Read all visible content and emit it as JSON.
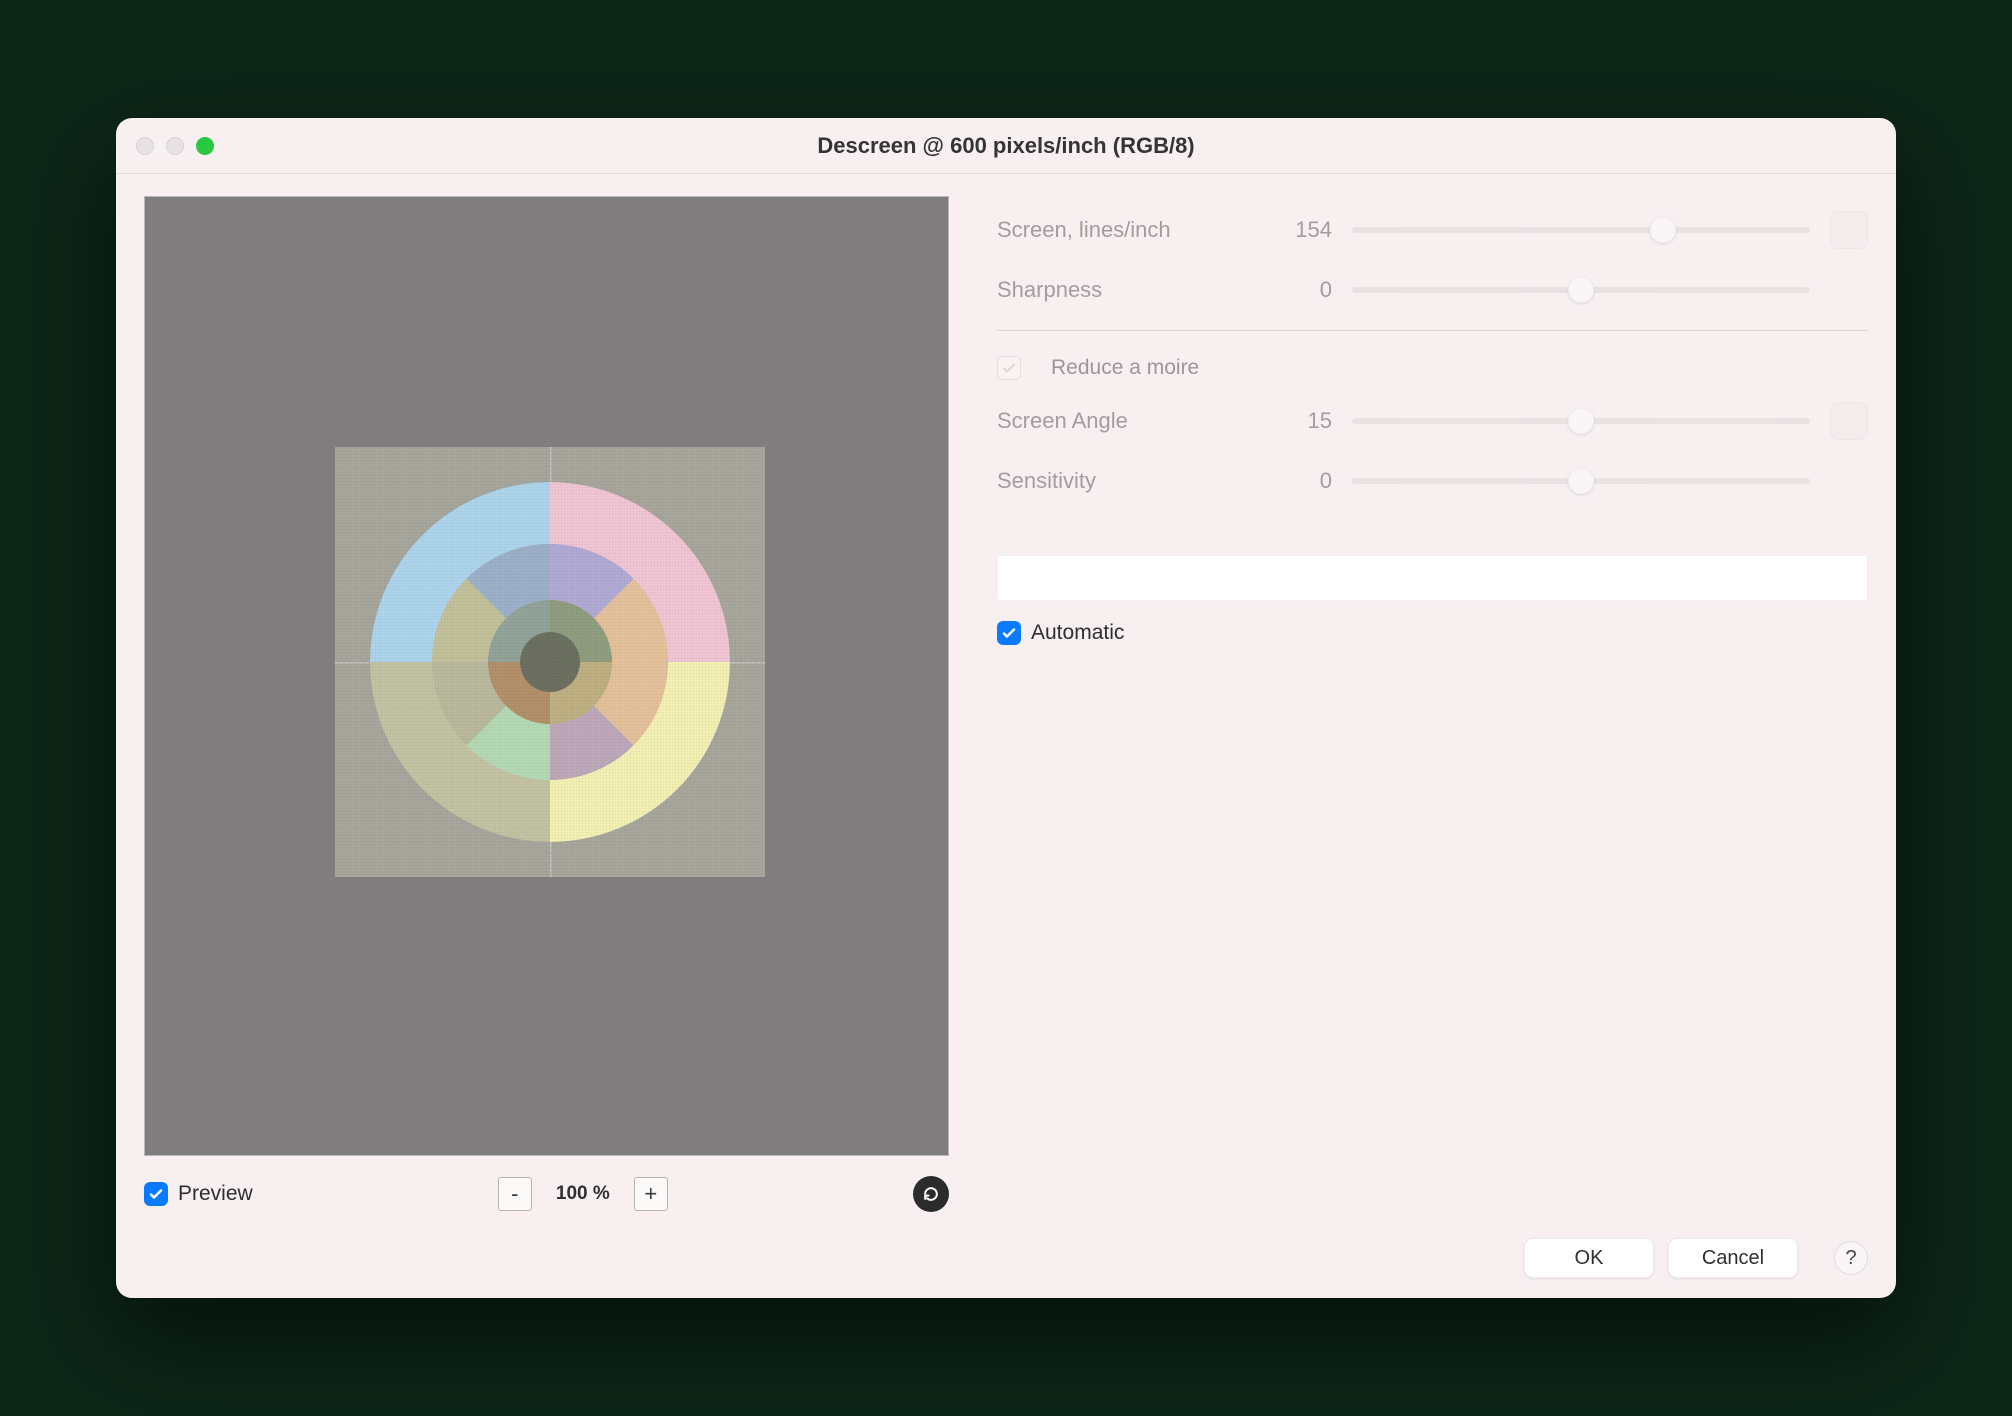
{
  "window": {
    "title": "Descreen @ 600 pixels/inch (RGB/8)"
  },
  "preview": {
    "checkbox_label": "Preview",
    "checked": true,
    "zoom_minus": "-",
    "zoom_plus": "+",
    "zoom_value": "100 %"
  },
  "params": {
    "screen_lines": {
      "label": "Screen, lines/inch",
      "value": "154",
      "pos_pct": 68
    },
    "sharpness": {
      "label": "Sharpness",
      "value": "0",
      "pos_pct": 50
    },
    "reduce_moire": {
      "label": "Reduce a moire",
      "checked": true
    },
    "screen_angle": {
      "label": "Screen Angle",
      "value": "15",
      "pos_pct": 50
    },
    "sensitivity": {
      "label": "Sensitivity",
      "value": "0",
      "pos_pct": 50
    }
  },
  "automatic": {
    "label": "Automatic",
    "checked": true
  },
  "actions": {
    "ok": "OK",
    "cancel": "Cancel",
    "help": "?"
  }
}
